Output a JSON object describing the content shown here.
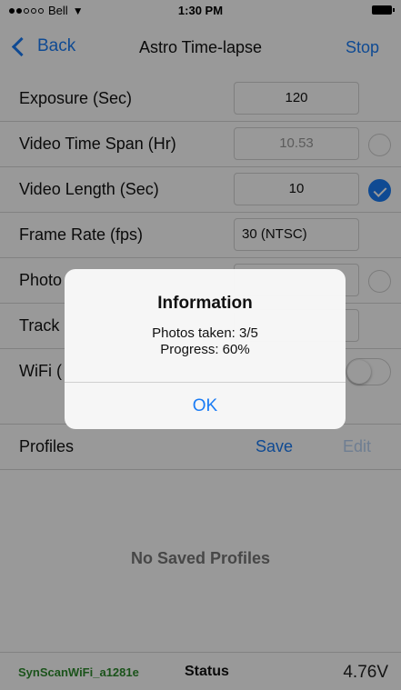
{
  "status_bar": {
    "carrier": "Bell",
    "time": "1:30 PM",
    "wifi_icon": "wifi-icon",
    "battery_icon": "battery-icon"
  },
  "nav": {
    "back_label": "Back",
    "title": "Astro Time-lapse",
    "stop_label": "Stop"
  },
  "rows": [
    {
      "label": "Exposure (Sec)",
      "value": "120"
    },
    {
      "label": "Video Time Span (Hr)",
      "value": "10.53",
      "radio_checked": false
    },
    {
      "label": "Video Length (Sec)",
      "value": "10",
      "radio_checked": true
    },
    {
      "label": "Frame Rate (fps)",
      "value": "30 (NTSC)"
    },
    {
      "label": "Photo"
    },
    {
      "label": "Track"
    },
    {
      "label": "WiFi ("
    }
  ],
  "profiles": {
    "label": "Profiles",
    "save_label": "Save",
    "edit_label": "Edit",
    "empty_text": "No Saved Profiles"
  },
  "bottom_bar": {
    "ssid": "SynScanWiFi_a1281e",
    "status_label": "Status",
    "voltage": "4.76V"
  },
  "alert": {
    "title": "Information",
    "line1": "Photos taken: 3/5",
    "line2": "Progress: 60%",
    "ok_label": "OK"
  },
  "colors": {
    "accent": "#1a7cf5",
    "ssid_green": "#2e8b2e"
  }
}
